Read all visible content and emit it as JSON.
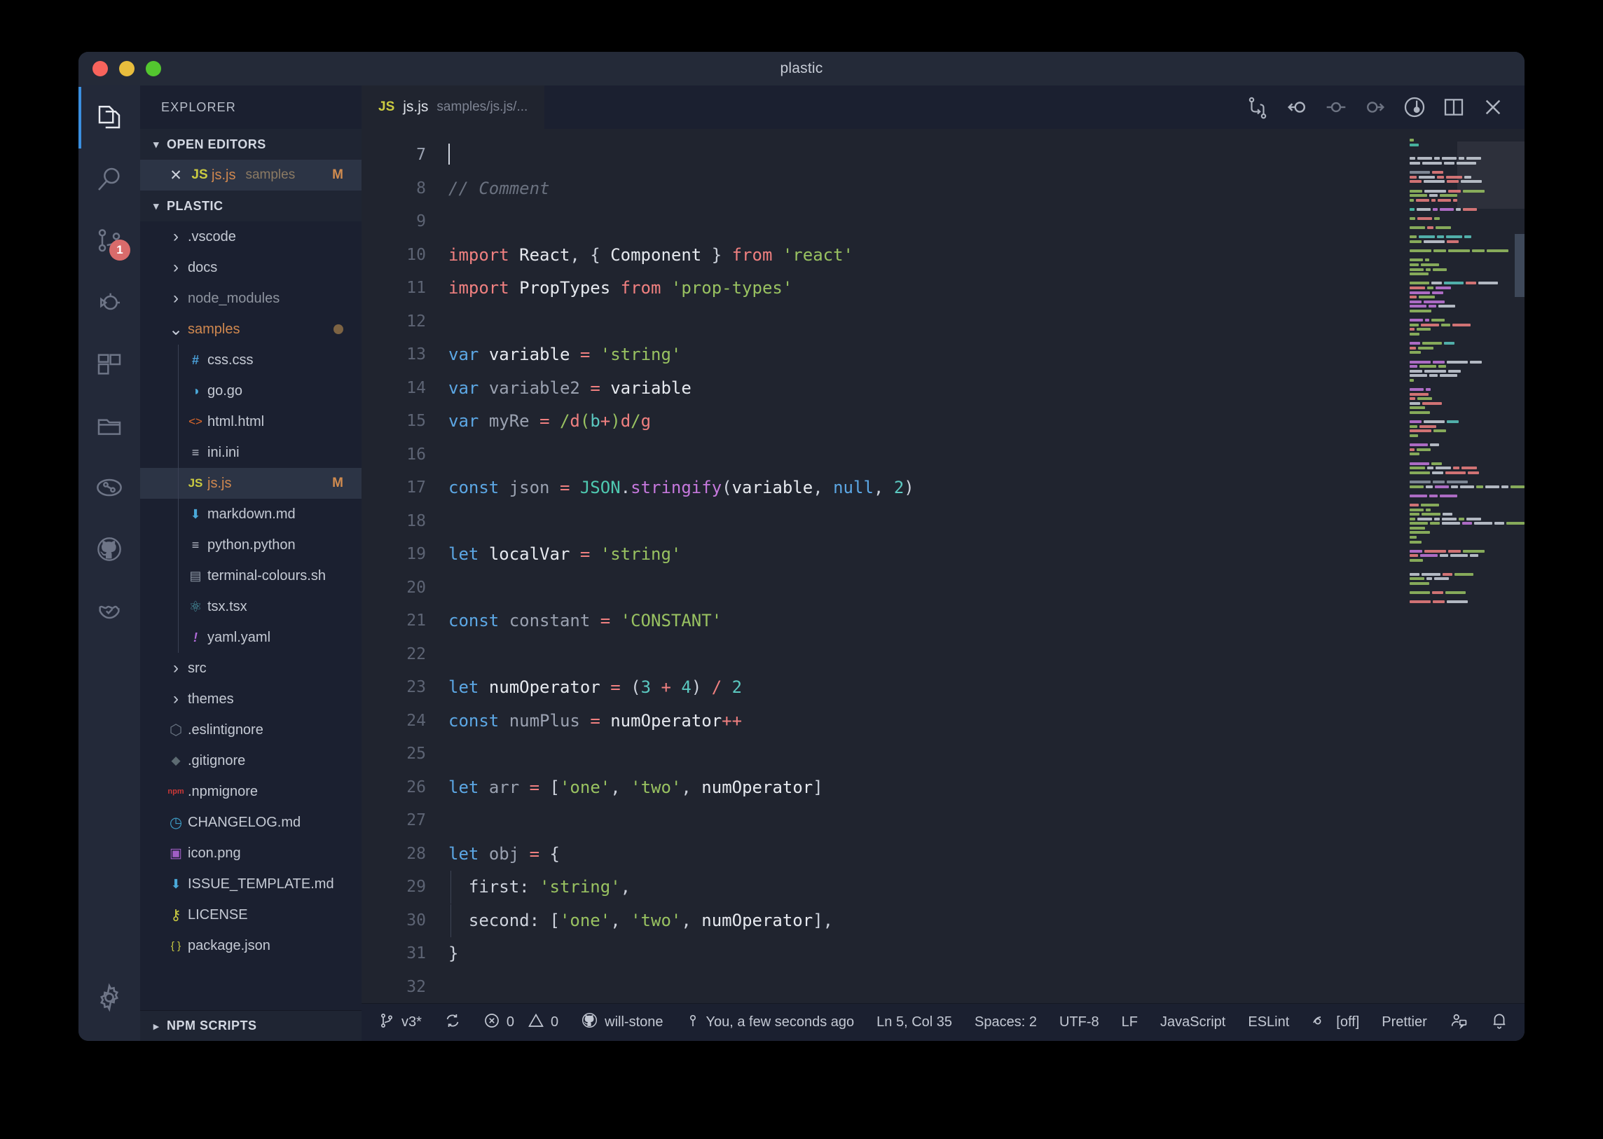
{
  "window": {
    "title": "plastic"
  },
  "activity_bar": {
    "items": [
      {
        "name": "explorer",
        "icon": "files-icon",
        "active": true
      },
      {
        "name": "search",
        "icon": "search-icon",
        "active": false
      },
      {
        "name": "source-control",
        "icon": "source-control-icon",
        "active": false,
        "badge": "1"
      },
      {
        "name": "run-and-debug",
        "icon": "debug-icon",
        "active": false
      },
      {
        "name": "extensions",
        "icon": "extensions-icon",
        "active": false
      },
      {
        "name": "remote-explorer",
        "icon": "folder-icon",
        "active": false
      },
      {
        "name": "gitlens",
        "icon": "gitlens-icon",
        "active": false
      },
      {
        "name": "github",
        "icon": "github-icon",
        "active": false
      },
      {
        "name": "testing",
        "icon": "beaker-check-icon",
        "active": false
      }
    ],
    "settings": {
      "name": "manage",
      "icon": "gear-icon"
    }
  },
  "sidebar": {
    "title": "EXPLORER",
    "open_editors": {
      "label": "OPEN EDITORS",
      "expanded": true,
      "items": [
        {
          "name": "js.js",
          "folder": "samples",
          "badge": "M",
          "icon": "js-icon",
          "selected": true
        }
      ]
    },
    "workspace": {
      "label": "PLASTIC",
      "expanded": true,
      "items": [
        {
          "label": ".vscode",
          "type": "folder",
          "depth": 0,
          "expanded": false,
          "icon": "chevron-right-icon"
        },
        {
          "label": "docs",
          "type": "folder",
          "depth": 0,
          "expanded": false,
          "icon": "chevron-right-icon"
        },
        {
          "label": "node_modules",
          "type": "folder",
          "depth": 0,
          "expanded": false,
          "icon": "chevron-right-icon",
          "dim": true
        },
        {
          "label": "samples",
          "type": "folder",
          "depth": 0,
          "expanded": true,
          "icon": "chevron-down-icon",
          "modified": true,
          "color": "#d0884f"
        },
        {
          "label": "css.css",
          "type": "file",
          "depth": 1,
          "icon": "css-icon"
        },
        {
          "label": "go.go",
          "type": "file",
          "depth": 1,
          "icon": "go-icon"
        },
        {
          "label": "html.html",
          "type": "file",
          "depth": 1,
          "icon": "html-icon"
        },
        {
          "label": "ini.ini",
          "type": "file",
          "depth": 1,
          "icon": "ini-icon"
        },
        {
          "label": "js.js",
          "type": "file",
          "depth": 1,
          "icon": "js-icon",
          "badge": "M",
          "selected": true,
          "color": "#d0884f"
        },
        {
          "label": "markdown.md",
          "type": "file",
          "depth": 1,
          "icon": "markdown-icon"
        },
        {
          "label": "python.python",
          "type": "file",
          "depth": 1,
          "icon": "ini-icon"
        },
        {
          "label": "terminal-colours.sh",
          "type": "file",
          "depth": 1,
          "icon": "shell-icon"
        },
        {
          "label": "tsx.tsx",
          "type": "file",
          "depth": 1,
          "icon": "react-icon"
        },
        {
          "label": "yaml.yaml",
          "type": "file",
          "depth": 1,
          "icon": "yaml-icon"
        },
        {
          "label": "src",
          "type": "folder",
          "depth": 0,
          "expanded": false,
          "icon": "chevron-right-icon"
        },
        {
          "label": "themes",
          "type": "folder",
          "depth": 0,
          "expanded": false,
          "icon": "chevron-right-icon"
        },
        {
          "label": ".eslintignore",
          "type": "file",
          "depth": 0,
          "icon": "eslint-icon"
        },
        {
          "label": ".gitignore",
          "type": "file",
          "depth": 0,
          "icon": "git-icon"
        },
        {
          "label": ".npmignore",
          "type": "file",
          "depth": 0,
          "icon": "npm-icon"
        },
        {
          "label": "CHANGELOG.md",
          "type": "file",
          "depth": 0,
          "icon": "clock-icon"
        },
        {
          "label": "icon.png",
          "type": "file",
          "depth": 0,
          "icon": "image-icon"
        },
        {
          "label": "ISSUE_TEMPLATE.md",
          "type": "file",
          "depth": 0,
          "icon": "markdown-icon"
        },
        {
          "label": "LICENSE",
          "type": "file",
          "depth": 0,
          "icon": "key-icon"
        },
        {
          "label": "package.json",
          "type": "file",
          "depth": 0,
          "icon": "json-icon"
        }
      ]
    },
    "npm_scripts": {
      "label": "NPM SCRIPTS",
      "expanded": false
    }
  },
  "editor": {
    "tab": {
      "icon": "js-icon",
      "name": "js.js",
      "path": "samples/js.js/..."
    },
    "actions": [
      {
        "name": "compare-changes-icon"
      },
      {
        "name": "previous-change-icon"
      },
      {
        "name": "open-change-icon"
      },
      {
        "name": "next-change-icon"
      },
      {
        "name": "blame-icon"
      },
      {
        "name": "split-editor-icon"
      },
      {
        "name": "close-editor-icon"
      }
    ],
    "first_line": 7,
    "lines": [
      {
        "n": 7,
        "tokens": [
          {
            "t": "",
            "c": "cursor"
          }
        ]
      },
      {
        "n": 8,
        "tokens": [
          {
            "t": "// Comment",
            "c": "cmt"
          }
        ]
      },
      {
        "n": 9,
        "tokens": []
      },
      {
        "n": 10,
        "tokens": [
          {
            "t": "import",
            "c": "kw2"
          },
          {
            "t": " ",
            "c": "pn"
          },
          {
            "t": "React",
            "c": "vr"
          },
          {
            "t": ", { ",
            "c": "pn"
          },
          {
            "t": "Component",
            "c": "vr"
          },
          {
            "t": " } ",
            "c": "pn"
          },
          {
            "t": "from",
            "c": "kw2"
          },
          {
            "t": " ",
            "c": "pn"
          },
          {
            "t": "'react'",
            "c": "str"
          }
        ]
      },
      {
        "n": 11,
        "tokens": [
          {
            "t": "import",
            "c": "kw2"
          },
          {
            "t": " ",
            "c": "pn"
          },
          {
            "t": "PropTypes",
            "c": "vr"
          },
          {
            "t": " ",
            "c": "pn"
          },
          {
            "t": "from",
            "c": "kw2"
          },
          {
            "t": " ",
            "c": "pn"
          },
          {
            "t": "'prop-types'",
            "c": "str"
          }
        ]
      },
      {
        "n": 12,
        "tokens": []
      },
      {
        "n": 13,
        "tokens": [
          {
            "t": "var",
            "c": "kw"
          },
          {
            "t": " ",
            "c": "pn"
          },
          {
            "t": "variable",
            "c": "vr"
          },
          {
            "t": " ",
            "c": "pn"
          },
          {
            "t": "=",
            "c": "op"
          },
          {
            "t": " ",
            "c": "pn"
          },
          {
            "t": "'string'",
            "c": "str"
          }
        ]
      },
      {
        "n": 14,
        "tokens": [
          {
            "t": "var",
            "c": "kw"
          },
          {
            "t": " ",
            "c": "pn"
          },
          {
            "t": "variable2",
            "c": "cst"
          },
          {
            "t": " ",
            "c": "pn"
          },
          {
            "t": "=",
            "c": "op"
          },
          {
            "t": " ",
            "c": "pn"
          },
          {
            "t": "variable",
            "c": "vr"
          }
        ]
      },
      {
        "n": 15,
        "tokens": [
          {
            "t": "var",
            "c": "kw"
          },
          {
            "t": " ",
            "c": "pn"
          },
          {
            "t": "myRe",
            "c": "cst"
          },
          {
            "t": " ",
            "c": "pn"
          },
          {
            "t": "=",
            "c": "op"
          },
          {
            "t": " ",
            "c": "pn"
          },
          {
            "t": "/",
            "c": "str"
          },
          {
            "t": "d",
            "c": "op"
          },
          {
            "t": "(",
            "c": "str"
          },
          {
            "t": "b",
            "c": "num"
          },
          {
            "t": "+",
            "c": "op"
          },
          {
            "t": ")",
            "c": "str"
          },
          {
            "t": "d",
            "c": "op"
          },
          {
            "t": "/",
            "c": "str"
          },
          {
            "t": "g",
            "c": "op"
          }
        ]
      },
      {
        "n": 16,
        "tokens": []
      },
      {
        "n": 17,
        "tokens": [
          {
            "t": "const",
            "c": "kw"
          },
          {
            "t": " ",
            "c": "pn"
          },
          {
            "t": "json",
            "c": "cst"
          },
          {
            "t": " ",
            "c": "pn"
          },
          {
            "t": "=",
            "c": "op"
          },
          {
            "t": " ",
            "c": "pn"
          },
          {
            "t": "JSON",
            "c": "cls"
          },
          {
            "t": ".",
            "c": "pn"
          },
          {
            "t": "stringify",
            "c": "fn"
          },
          {
            "t": "(",
            "c": "pn"
          },
          {
            "t": "variable",
            "c": "vr"
          },
          {
            "t": ", ",
            "c": "pn"
          },
          {
            "t": "null",
            "c": "kw"
          },
          {
            "t": ", ",
            "c": "pn"
          },
          {
            "t": "2",
            "c": "num"
          },
          {
            "t": ")",
            "c": "pn"
          }
        ]
      },
      {
        "n": 18,
        "tokens": []
      },
      {
        "n": 19,
        "tokens": [
          {
            "t": "let",
            "c": "kw"
          },
          {
            "t": " ",
            "c": "pn"
          },
          {
            "t": "localVar",
            "c": "vr"
          },
          {
            "t": " ",
            "c": "pn"
          },
          {
            "t": "=",
            "c": "op"
          },
          {
            "t": " ",
            "c": "pn"
          },
          {
            "t": "'string'",
            "c": "str"
          }
        ]
      },
      {
        "n": 20,
        "tokens": []
      },
      {
        "n": 21,
        "tokens": [
          {
            "t": "const",
            "c": "kw"
          },
          {
            "t": " ",
            "c": "pn"
          },
          {
            "t": "constant",
            "c": "cst"
          },
          {
            "t": " ",
            "c": "pn"
          },
          {
            "t": "=",
            "c": "op"
          },
          {
            "t": " ",
            "c": "pn"
          },
          {
            "t": "'CONSTANT'",
            "c": "str"
          }
        ]
      },
      {
        "n": 22,
        "tokens": []
      },
      {
        "n": 23,
        "tokens": [
          {
            "t": "let",
            "c": "kw"
          },
          {
            "t": " ",
            "c": "pn"
          },
          {
            "t": "numOperator",
            "c": "vr"
          },
          {
            "t": " ",
            "c": "pn"
          },
          {
            "t": "=",
            "c": "op"
          },
          {
            "t": " ",
            "c": "pn"
          },
          {
            "t": "(",
            "c": "pn"
          },
          {
            "t": "3",
            "c": "num"
          },
          {
            "t": " ",
            "c": "pn"
          },
          {
            "t": "+",
            "c": "op"
          },
          {
            "t": " ",
            "c": "pn"
          },
          {
            "t": "4",
            "c": "num"
          },
          {
            "t": ") ",
            "c": "pn"
          },
          {
            "t": "/",
            "c": "op"
          },
          {
            "t": " ",
            "c": "pn"
          },
          {
            "t": "2",
            "c": "num"
          }
        ]
      },
      {
        "n": 24,
        "tokens": [
          {
            "t": "const",
            "c": "kw"
          },
          {
            "t": " ",
            "c": "pn"
          },
          {
            "t": "numPlus",
            "c": "cst"
          },
          {
            "t": " ",
            "c": "pn"
          },
          {
            "t": "=",
            "c": "op"
          },
          {
            "t": " ",
            "c": "pn"
          },
          {
            "t": "numOperator",
            "c": "vr"
          },
          {
            "t": "++",
            "c": "op"
          }
        ]
      },
      {
        "n": 25,
        "tokens": []
      },
      {
        "n": 26,
        "tokens": [
          {
            "t": "let",
            "c": "kw"
          },
          {
            "t": " ",
            "c": "pn"
          },
          {
            "t": "arr",
            "c": "cst"
          },
          {
            "t": " ",
            "c": "pn"
          },
          {
            "t": "=",
            "c": "op"
          },
          {
            "t": " [",
            "c": "pn"
          },
          {
            "t": "'one'",
            "c": "str"
          },
          {
            "t": ", ",
            "c": "pn"
          },
          {
            "t": "'two'",
            "c": "str"
          },
          {
            "t": ", ",
            "c": "pn"
          },
          {
            "t": "numOperator",
            "c": "vr"
          },
          {
            "t": "]",
            "c": "pn"
          }
        ]
      },
      {
        "n": 27,
        "tokens": []
      },
      {
        "n": 28,
        "tokens": [
          {
            "t": "let",
            "c": "kw"
          },
          {
            "t": " ",
            "c": "pn"
          },
          {
            "t": "obj",
            "c": "cst"
          },
          {
            "t": " ",
            "c": "pn"
          },
          {
            "t": "=",
            "c": "op"
          },
          {
            "t": " {",
            "c": "pn"
          }
        ]
      },
      {
        "n": 29,
        "tokens": [
          {
            "t": "  first: ",
            "c": "prop"
          },
          {
            "t": "'string'",
            "c": "str"
          },
          {
            "t": ",",
            "c": "pn"
          }
        ]
      },
      {
        "n": 30,
        "tokens": [
          {
            "t": "  second: [",
            "c": "prop"
          },
          {
            "t": "'one'",
            "c": "str"
          },
          {
            "t": ", ",
            "c": "pn"
          },
          {
            "t": "'two'",
            "c": "str"
          },
          {
            "t": ", ",
            "c": "pn"
          },
          {
            "t": "numOperator",
            "c": "vr"
          },
          {
            "t": "],",
            "c": "pn"
          }
        ]
      },
      {
        "n": 31,
        "tokens": [
          {
            "t": "}",
            "c": "pn"
          }
        ]
      },
      {
        "n": 32,
        "tokens": []
      }
    ]
  },
  "status_bar": {
    "left": [
      {
        "name": "branch",
        "icon": "git-branch-icon",
        "label": "v3*"
      },
      {
        "name": "sync",
        "icon": "sync-icon",
        "label": ""
      },
      {
        "name": "problems",
        "icon": "error-icon",
        "label": "0",
        "icon2": "warning-icon",
        "label2": "0"
      },
      {
        "name": "github-account",
        "icon": "github-icon",
        "label": "will-stone"
      }
    ],
    "right": [
      {
        "name": "blame",
        "icon": "blame-dot-icon",
        "label": "You, a few seconds ago"
      },
      {
        "name": "cursor-position",
        "label": "Ln 5, Col 35"
      },
      {
        "name": "indentation",
        "label": "Spaces: 2"
      },
      {
        "name": "encoding",
        "label": "UTF-8"
      },
      {
        "name": "eol",
        "label": "LF"
      },
      {
        "name": "language-mode",
        "label": "JavaScript"
      },
      {
        "name": "eslint",
        "label": "ESLint"
      },
      {
        "name": "eye-toggle",
        "icon": "eye-icon",
        "label": "[off]"
      },
      {
        "name": "prettier",
        "label": "Prettier"
      },
      {
        "name": "live-share",
        "icon": "live-share-icon",
        "label": ""
      },
      {
        "name": "notifications",
        "icon": "bell-icon",
        "label": ""
      }
    ]
  },
  "colors": {
    "accent": "#3a8fe0",
    "editor_bg": "#20242f",
    "sidebar_bg": "#1b2030",
    "activitybar_bg": "#232939",
    "titlebar_bg": "#242a38",
    "badge": "#d96b6b",
    "keyword": "#5ca7e4",
    "keyword_import": "#f08080",
    "string": "#99c261",
    "number": "#5bc8c0",
    "operator": "#f08080",
    "function": "#c678dd",
    "class": "#4ec9b0",
    "comment": "#6b7280",
    "modified": "#d0884f"
  }
}
